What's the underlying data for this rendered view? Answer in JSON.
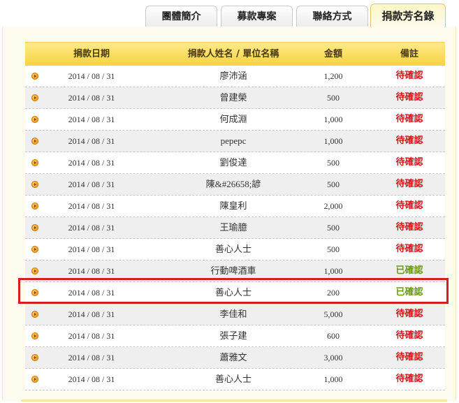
{
  "tabs": [
    {
      "label": "團體簡介",
      "active": false
    },
    {
      "label": "募款專案",
      "active": false
    },
    {
      "label": "聯絡方式",
      "active": false
    },
    {
      "label": "捐款芳名錄",
      "active": true
    }
  ],
  "table": {
    "headers": {
      "date": "捐款日期",
      "name": "捐款人姓名 / 單位名稱",
      "amount": "金額",
      "note": "備註"
    },
    "rows": [
      {
        "date": "2014 / 08 / 31",
        "name": "廖沛涵",
        "amount": "1,200",
        "note": "待確認",
        "status": "pending"
      },
      {
        "date": "2014 / 08 / 31",
        "name": "曾建榮",
        "amount": "500",
        "note": "待確認",
        "status": "pending"
      },
      {
        "date": "2014 / 08 / 31",
        "name": "何成淵",
        "amount": "1,000",
        "note": "待確認",
        "status": "pending"
      },
      {
        "date": "2014 / 08 / 31",
        "name": "pepepc",
        "amount": "1,000",
        "note": "待確認",
        "status": "pending"
      },
      {
        "date": "2014 / 08 / 31",
        "name": "劉俊達",
        "amount": "500",
        "note": "待確認",
        "status": "pending"
      },
      {
        "date": "2014 / 08 / 31",
        "name": "陳&#26658;諺",
        "amount": "500",
        "note": "待確認",
        "status": "pending"
      },
      {
        "date": "2014 / 08 / 31",
        "name": "陳皇利",
        "amount": "2,000",
        "note": "待確認",
        "status": "pending"
      },
      {
        "date": "2014 / 08 / 31",
        "name": "王瑜臆",
        "amount": "500",
        "note": "待確認",
        "status": "pending"
      },
      {
        "date": "2014 / 08 / 31",
        "name": "善心人士",
        "amount": "500",
        "note": "待確認",
        "status": "pending"
      },
      {
        "date": "2014 / 08 / 31",
        "name": "行動啤酒車",
        "amount": "1,000",
        "note": "已確認",
        "status": "confirmed"
      },
      {
        "date": "2014 / 08 / 31",
        "name": "善心人士",
        "amount": "200",
        "note": "已確認",
        "status": "confirmed"
      },
      {
        "date": "2014 / 08 / 31",
        "name": "李佳和",
        "amount": "5,000",
        "note": "待確認",
        "status": "pending"
      },
      {
        "date": "2014 / 08 / 31",
        "name": "張子建",
        "amount": "600",
        "note": "待確認",
        "status": "pending"
      },
      {
        "date": "2014 / 08 / 31",
        "name": "蕭雅文",
        "amount": "3,000",
        "note": "待確認",
        "status": "pending"
      },
      {
        "date": "2014 / 08 / 31",
        "name": "善心人士",
        "amount": "1,000",
        "note": "待確認",
        "status": "pending"
      }
    ]
  },
  "highlighted_row_index": 10,
  "colors": {
    "pending": "#d8141a",
    "confirmed": "#6a9a10",
    "header": "#f6d33c",
    "highlight_border": "#d81c24"
  }
}
